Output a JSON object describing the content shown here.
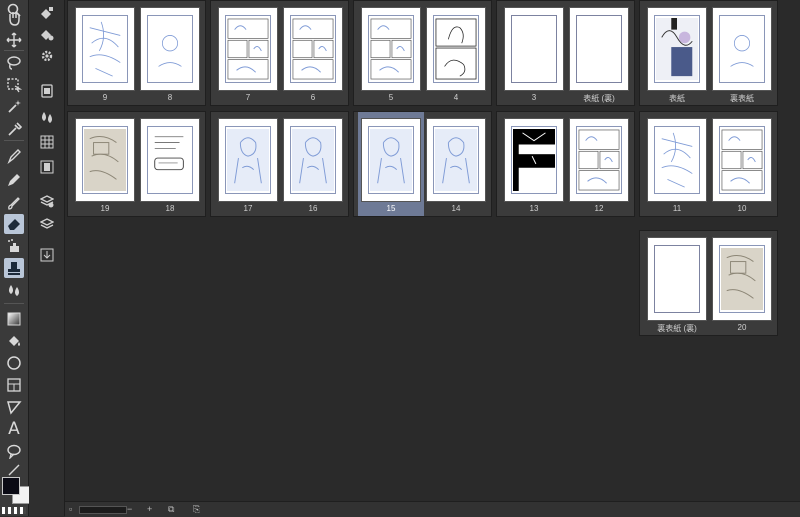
{
  "colors": {
    "accent": "#6e7a96",
    "sketch": "#7f9bd6",
    "toolbar": "#3a3a3a"
  },
  "tools": [
    "zoom-icon",
    "hand-icon",
    "move-icon",
    "lasso-icon",
    "select-icon",
    "magic-wand-icon",
    "eyedropper-icon",
    "pen-icon",
    "pencil-icon",
    "brush-icon",
    "eraser-icon",
    "airbrush-icon",
    "stamp-icon",
    "blend-icon",
    "gradient-icon",
    "fill-icon",
    "shape-icon",
    "frame-icon",
    "ruler-icon",
    "text-icon",
    "balloon-icon",
    "line-icon"
  ],
  "commands": [
    "new-layer-icon",
    "duplicate-icon",
    "gear-icon",
    "page-icon",
    "drops-icon",
    "grid-icon",
    "film-icon",
    "layers-icon",
    "stack-icon",
    "export-icon"
  ],
  "spreads": [
    {
      "pages": [
        {
          "label": "9",
          "kind": "sketch"
        },
        {
          "label": "8",
          "kind": "light"
        }
      ]
    },
    {
      "pages": [
        {
          "label": "7",
          "kind": "panels"
        },
        {
          "label": "6",
          "kind": "panels"
        }
      ]
    },
    {
      "pages": [
        {
          "label": "5",
          "kind": "panels"
        },
        {
          "label": "4",
          "kind": "ink"
        }
      ]
    },
    {
      "pages": [
        {
          "label": "3",
          "kind": "blank"
        },
        {
          "label": "表紙 (裏)",
          "kind": "blank"
        }
      ]
    },
    {
      "pages": [
        {
          "label": "表紙",
          "kind": "cover"
        },
        {
          "label": "裏表紙",
          "kind": "light"
        }
      ]
    },
    {
      "pages": [
        {
          "label": "19",
          "kind": "photo"
        },
        {
          "label": "18",
          "kind": "notes"
        }
      ]
    },
    {
      "pages": [
        {
          "label": "17",
          "kind": "blue"
        },
        {
          "label": "16",
          "kind": "blue"
        }
      ]
    },
    {
      "pages": [
        {
          "label": "15",
          "kind": "blue"
        },
        {
          "label": "14",
          "kind": "blue"
        }
      ]
    },
    {
      "pages": [
        {
          "label": "13",
          "kind": "black"
        },
        {
          "label": "12",
          "kind": "panels"
        }
      ]
    },
    {
      "pages": [
        {
          "label": "11",
          "kind": "sketch"
        },
        {
          "label": "10",
          "kind": "panels"
        }
      ]
    },
    {
      "pages": [
        {
          "label": "裏表紙 (裏)",
          "kind": "blank"
        },
        {
          "label": "20",
          "kind": "photo"
        }
      ]
    }
  ],
  "selected_page": "15",
  "status": {
    "minus": "−",
    "plus": "+"
  }
}
